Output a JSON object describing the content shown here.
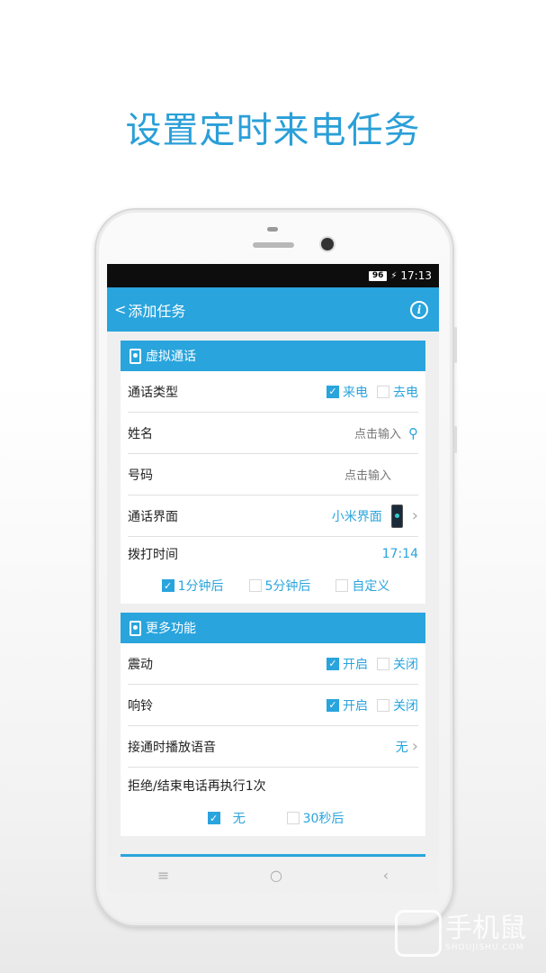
{
  "headline": "设置定时来电任务",
  "status": {
    "battery": "96",
    "time": "17:13"
  },
  "appbar": {
    "back_label": "添加任务",
    "back_glyph": "<",
    "info_glyph": "i"
  },
  "card1": {
    "title": "虚拟通话",
    "call_type": {
      "label": "通话类型",
      "opt_incoming": "来电",
      "opt_outgoing": "去电",
      "incoming_checked": true,
      "outgoing_checked": false
    },
    "name": {
      "label": "姓名",
      "placeholder": "点击输入"
    },
    "number": {
      "label": "号码",
      "placeholder": "点击输入"
    },
    "ui": {
      "label": "通话界面",
      "value": "小米界面"
    },
    "dial_time": {
      "label": "拨打时间",
      "value": "17:14"
    },
    "delay_options": [
      {
        "label": "1分钟后",
        "checked": true
      },
      {
        "label": "5分钟后",
        "checked": false
      },
      {
        "label": "自定义",
        "checked": false
      }
    ]
  },
  "card2": {
    "title": "更多功能",
    "vibrate": {
      "label": "震动",
      "on": "开启",
      "off": "关闭",
      "checked": "on"
    },
    "ring": {
      "label": "响铃",
      "on": "开启",
      "off": "关闭",
      "checked": "on"
    },
    "voice": {
      "label": "接通时播放语音",
      "value": "无"
    },
    "redo": {
      "label": "拒绝/结束电话再执行1次"
    },
    "redo_options": [
      {
        "label": "无",
        "checked": true
      },
      {
        "label": "30秒后",
        "checked": false
      }
    ]
  },
  "navbar": {
    "menu": "≡",
    "home": "○",
    "back": "‹"
  },
  "watermark": {
    "text": "手机鼠",
    "sub": "SHOUJISHU.COM"
  },
  "colors": {
    "accent": "#29a4dd",
    "headline": "#2a9fd8"
  }
}
